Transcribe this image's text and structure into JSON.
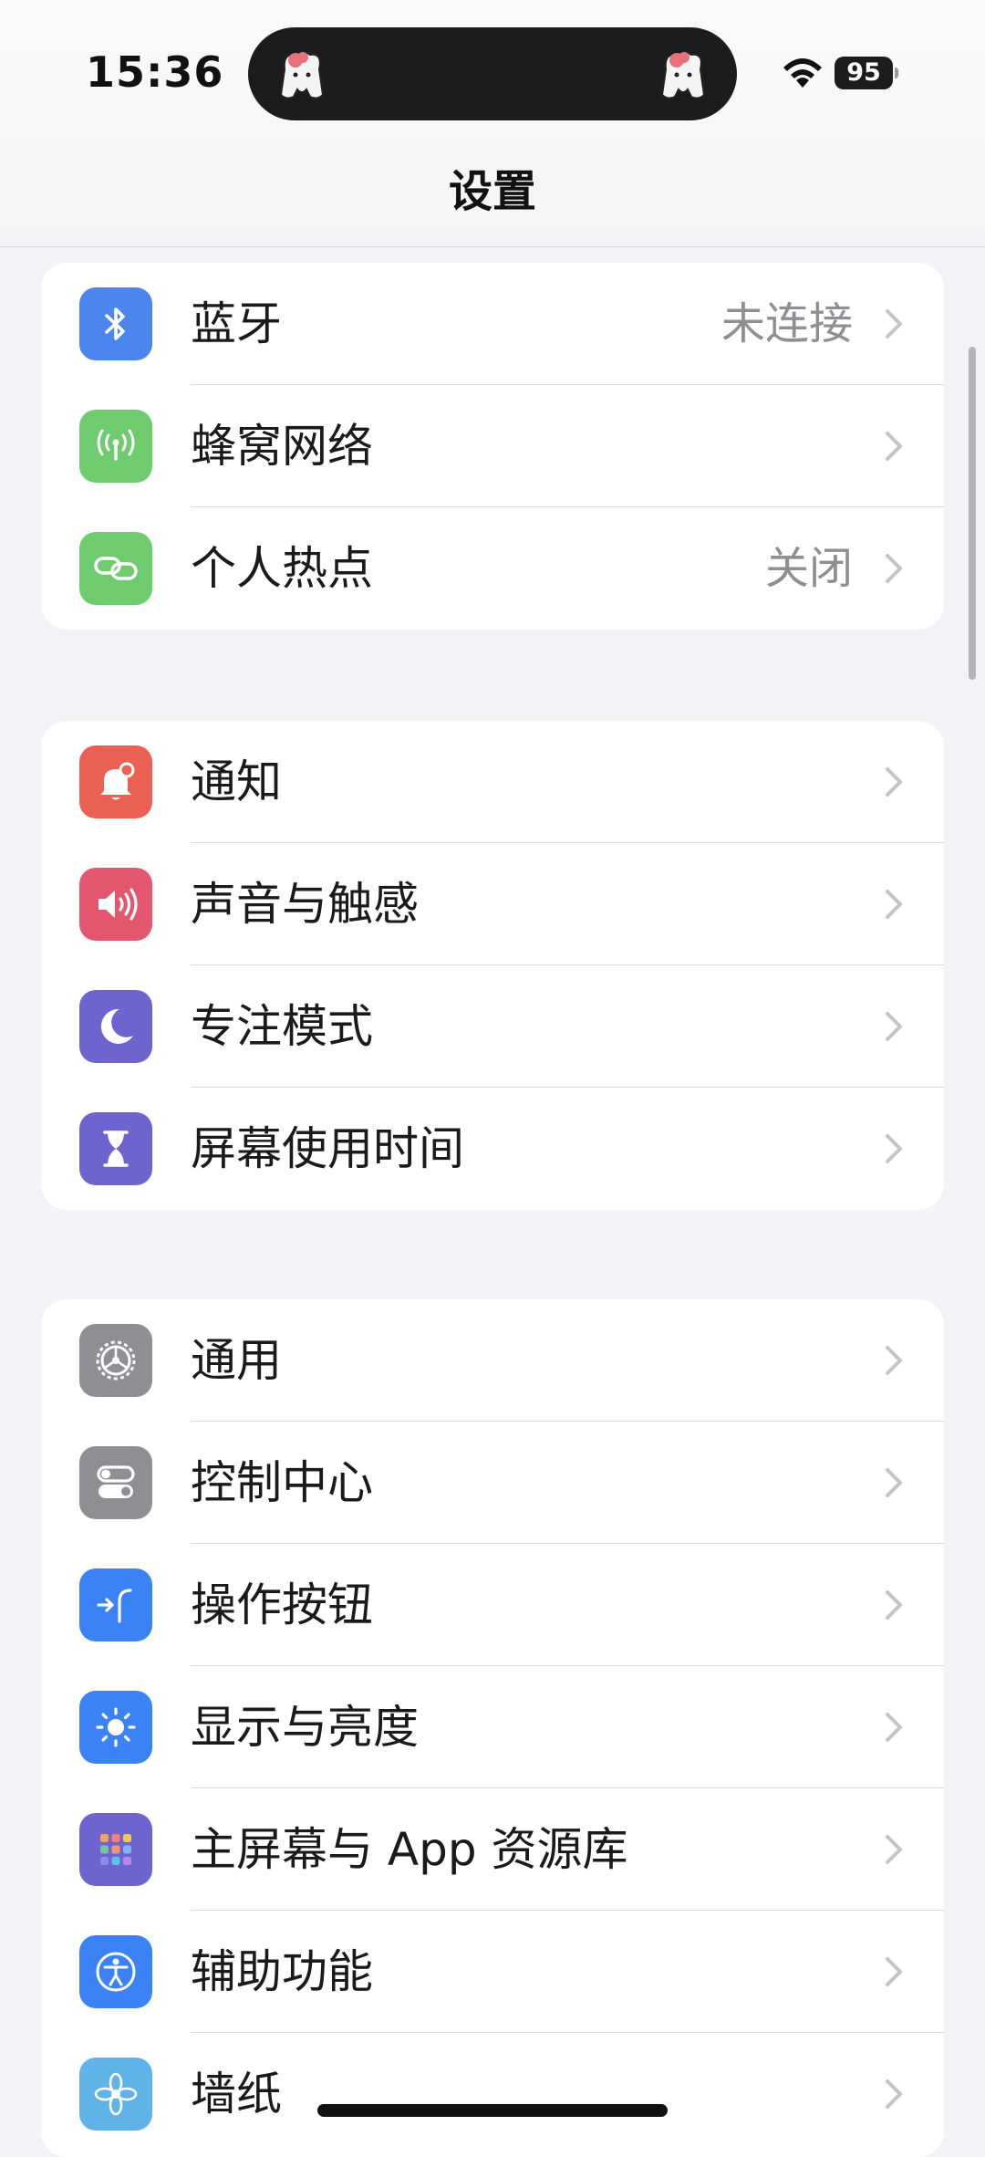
{
  "status_bar": {
    "time": "15:36",
    "battery": "95"
  },
  "nav": {
    "title": "设置"
  },
  "groups": [
    {
      "items": [
        {
          "label": "蓝牙",
          "value": "未连接",
          "icon": "bluetooth-icon",
          "color": "#3b82f6"
        },
        {
          "label": "蜂窝网络",
          "value": "",
          "icon": "cellular-icon",
          "color": "#34c759"
        },
        {
          "label": "个人热点",
          "value": "关闭",
          "icon": "hotspot-icon",
          "color": "#34c759"
        }
      ]
    },
    {
      "items": [
        {
          "label": "通知",
          "value": "",
          "icon": "notification-bell-icon",
          "color": "#ff3b30"
        },
        {
          "label": "声音与触感",
          "value": "",
          "icon": "speaker-icon",
          "color": "#ff2d55"
        },
        {
          "label": "专注模式",
          "value": "",
          "icon": "moon-icon",
          "color": "#5856d6"
        },
        {
          "label": "屏幕使用时间",
          "value": "",
          "icon": "hourglass-icon",
          "color": "#5856d6"
        }
      ]
    },
    {
      "items": [
        {
          "label": "通用",
          "value": "",
          "icon": "gear-icon",
          "color": "#8e8e93"
        },
        {
          "label": "控制中心",
          "value": "",
          "icon": "toggles-icon",
          "color": "#8e8e93"
        },
        {
          "label": "操作按钮",
          "value": "",
          "icon": "action-button-icon",
          "color": "#007aff"
        },
        {
          "label": "显示与亮度",
          "value": "",
          "icon": "brightness-sun-icon",
          "color": "#007aff"
        },
        {
          "label": "主屏幕与 App 资源库",
          "value": "",
          "icon": "app-grid-icon",
          "color": "#5856d6"
        },
        {
          "label": "辅助功能",
          "value": "",
          "icon": "accessibility-icon",
          "color": "#007aff"
        },
        {
          "label": "墙纸",
          "value": "",
          "icon": "wallpaper-flower-icon",
          "color": "#5ac8fa"
        }
      ]
    }
  ]
}
